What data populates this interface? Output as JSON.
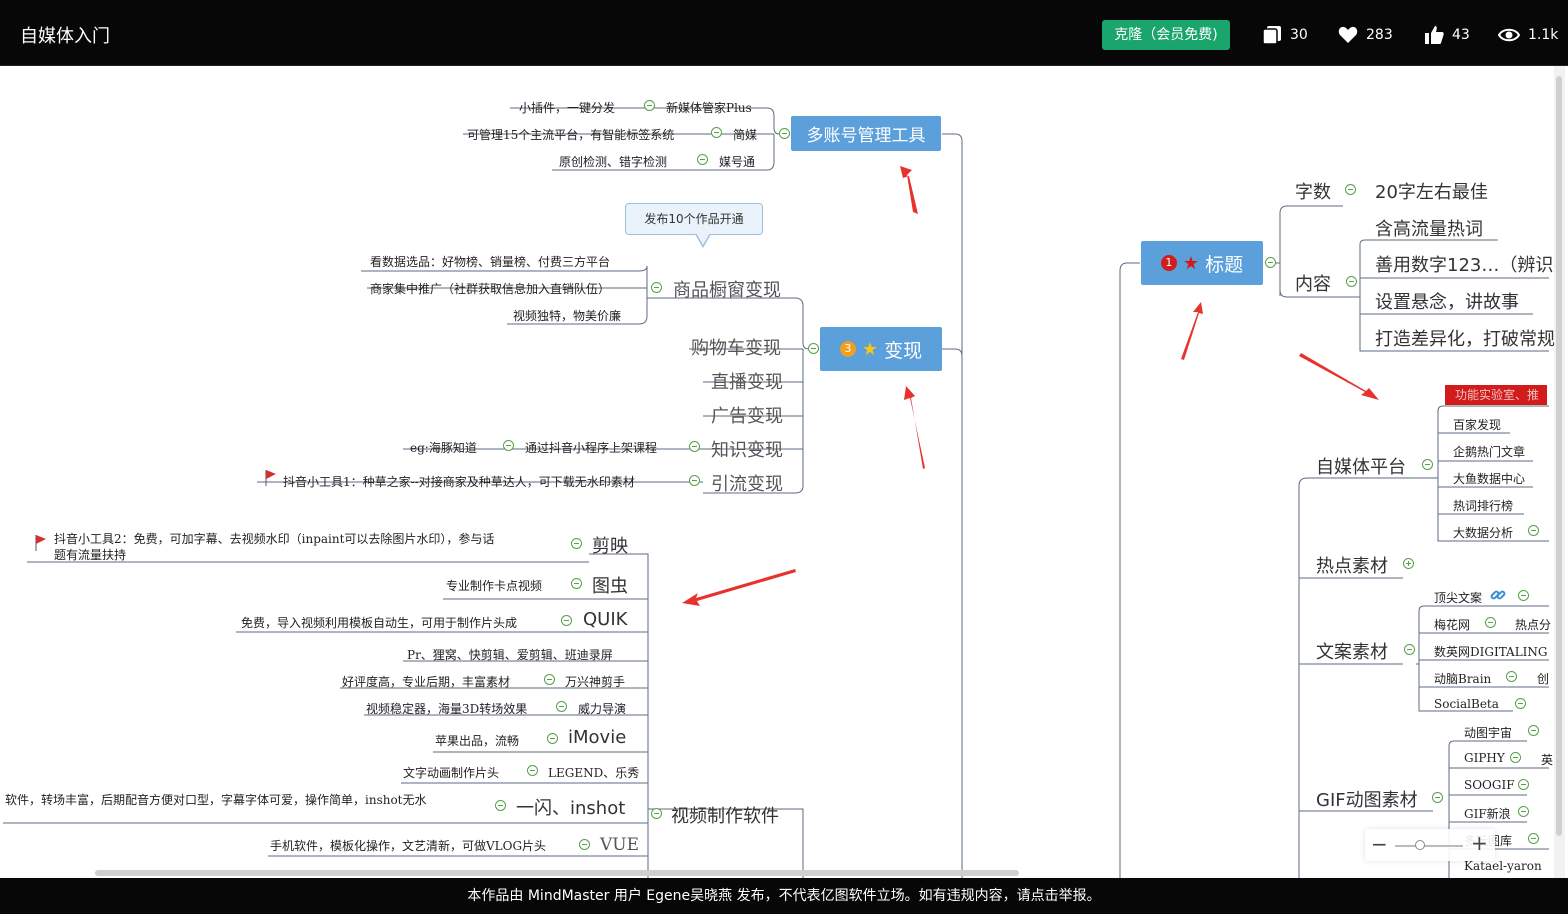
{
  "header": {
    "title": "自媒体入门",
    "clone_label": "克隆（会员免费)",
    "stats": {
      "copies": "30",
      "favorites": "283",
      "likes": "43",
      "views": "1.1k"
    }
  },
  "mindmap": {
    "multi_account": {
      "title": "多账号管理工具",
      "items": [
        {
          "name": "新媒体管家Plus",
          "note": "小插件，一键分发"
        },
        {
          "name": "简媒",
          "note": "可管理15个主流平台，有智能标签系统"
        },
        {
          "name": "媒号通",
          "note": "原创检测、错字检测"
        }
      ]
    },
    "monetize": {
      "badge": "3",
      "title": "变现",
      "callout": "发布10个作品开通",
      "window": {
        "title": "商品橱窗变现",
        "notes": [
          "看数据选品：好物榜、销量榜、付费三方平台",
          "商家集中推广（社群获取信息加入直销队伍）",
          "视频独特，物美价廉"
        ]
      },
      "cart": "购物车变现",
      "live": "直播变现",
      "ads": "广告变现",
      "knowledge": {
        "title": "知识变现",
        "child": "通过抖音小程序上架课程",
        "note": "eg:海豚知道"
      },
      "traffic": {
        "title": "引流变现",
        "note": "抖音小工具1：种草之家--对接商家及种草达人，可下载无水印素材"
      }
    },
    "video_software": {
      "title": "视频制作软件",
      "items": [
        {
          "name": "剪映",
          "note": "抖音小工具2：免费，可加字幕、去视频水印（inpaint可以去除图片水印），参与话",
          "note2": "题有流量扶持"
        },
        {
          "name": "图虫",
          "note": "专业制作卡点视频"
        },
        {
          "name": "QUIK",
          "note": "免费，导入视频利用模板自动生，可用于制作片头成"
        },
        {
          "name": "",
          "note": "Pr、狸窝、快剪辑、爱剪辑、班迪录屏"
        },
        {
          "name": "万兴神剪手",
          "note": "好评度高，专业后期，丰富素材"
        },
        {
          "name": "威力导演",
          "note": "视频稳定器，海量3D转场效果"
        },
        {
          "name": "iMovie",
          "note": "苹果出品，流畅"
        },
        {
          "name": "LEGEND、乐秀",
          "note": "文字动画制作片头"
        },
        {
          "name": "一闪、inshot",
          "note": "软件，转场丰富，后期配音方便对口型，字幕字体可爱，操作简单，inshot无水"
        },
        {
          "name": "VUE",
          "note": "手机软件，模板化操作，文艺清新，可做VLOG片头"
        }
      ]
    },
    "title_node": {
      "badge": "1",
      "title": "标题",
      "word_count": {
        "label": "字数",
        "value": "20字左右最佳"
      },
      "content": {
        "label": "内容",
        "items": [
          "含高流量热词",
          "善用数字123…（辨识",
          "设置悬念，讲故事",
          "打造差异化，打破常规"
        ]
      }
    },
    "platforms": {
      "title": "自媒体平台",
      "items": [
        "功能实验室、推",
        "百家发现",
        "企鹅热门文章",
        "大鱼数据中心",
        "热词排行榜",
        "大数据分析"
      ]
    },
    "hot": {
      "title": "热点素材"
    },
    "copy": {
      "title": "文案素材",
      "items": [
        "顶尖文案",
        "梅花网",
        "热点分",
        "数英网DIGITALING",
        "动脑Brain",
        "创",
        "SocialBeta"
      ]
    },
    "gif": {
      "title": "GIF动图素材",
      "items": [
        "动图宇宙",
        "GIPHY",
        "英",
        "SOOGIF",
        "GIF新浪",
        "多玩图库",
        "Katael-yaron"
      ]
    }
  },
  "footer": {
    "text": "本作品由 MindMaster 用户 Egene吴晓燕 发布，不代表亿图软件立场。如有违规内容，请点击举报。"
  },
  "colors": {
    "topic": "#5b9fdb",
    "toggle": "#58a04b",
    "clone": "#1aa56c",
    "arrow": "#e8322e",
    "flag": "#d32f2f"
  }
}
